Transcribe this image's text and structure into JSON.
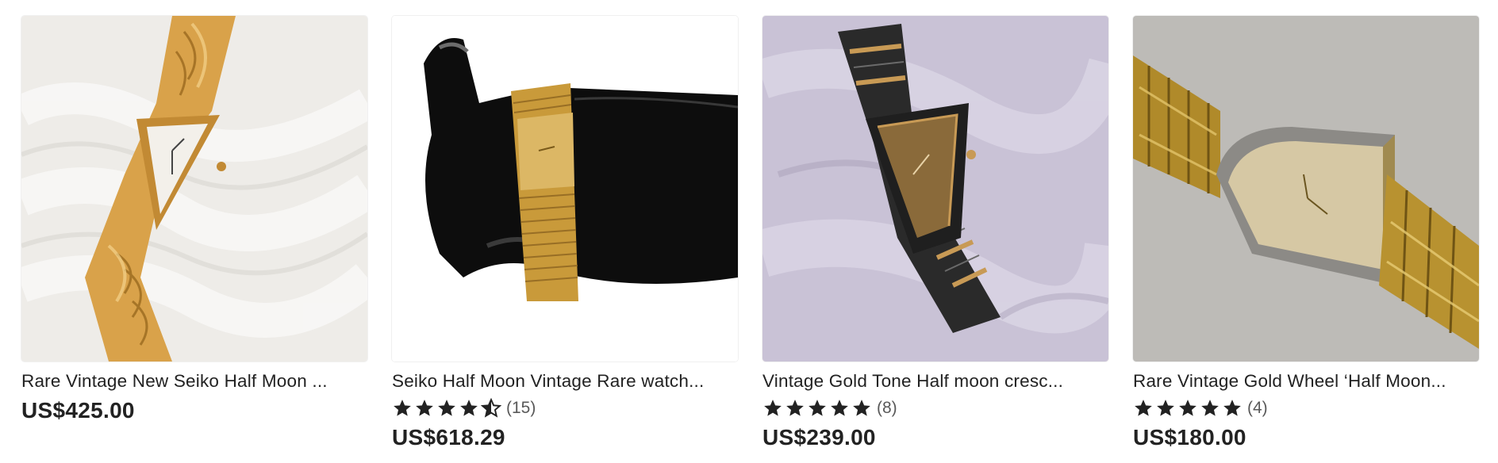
{
  "listings": [
    {
      "title": "Rare Vintage New Seiko Half Moon ...",
      "price": "US$425.00",
      "image_alt": "gold-bracelet-watch-on-white-fur"
    },
    {
      "title": "Seiko Half Moon Vintage Rare watch...",
      "rating_stars": 4.5,
      "rating_count": "(15)",
      "price": "US$618.29",
      "image_alt": "gold-watch-on-black-hand-stand"
    },
    {
      "title": "Vintage Gold Tone Half moon cresc...",
      "rating_stars": 5,
      "rating_count": "(8)",
      "price": "US$239.00",
      "image_alt": "two-tone-watch-on-lavender-fabric"
    },
    {
      "title": "Rare Vintage Gold Wheel ‘Half Moon...",
      "rating_stars": 5,
      "rating_count": "(4)",
      "price": "US$180.00",
      "image_alt": "gold-watch-on-grey-background"
    }
  ]
}
